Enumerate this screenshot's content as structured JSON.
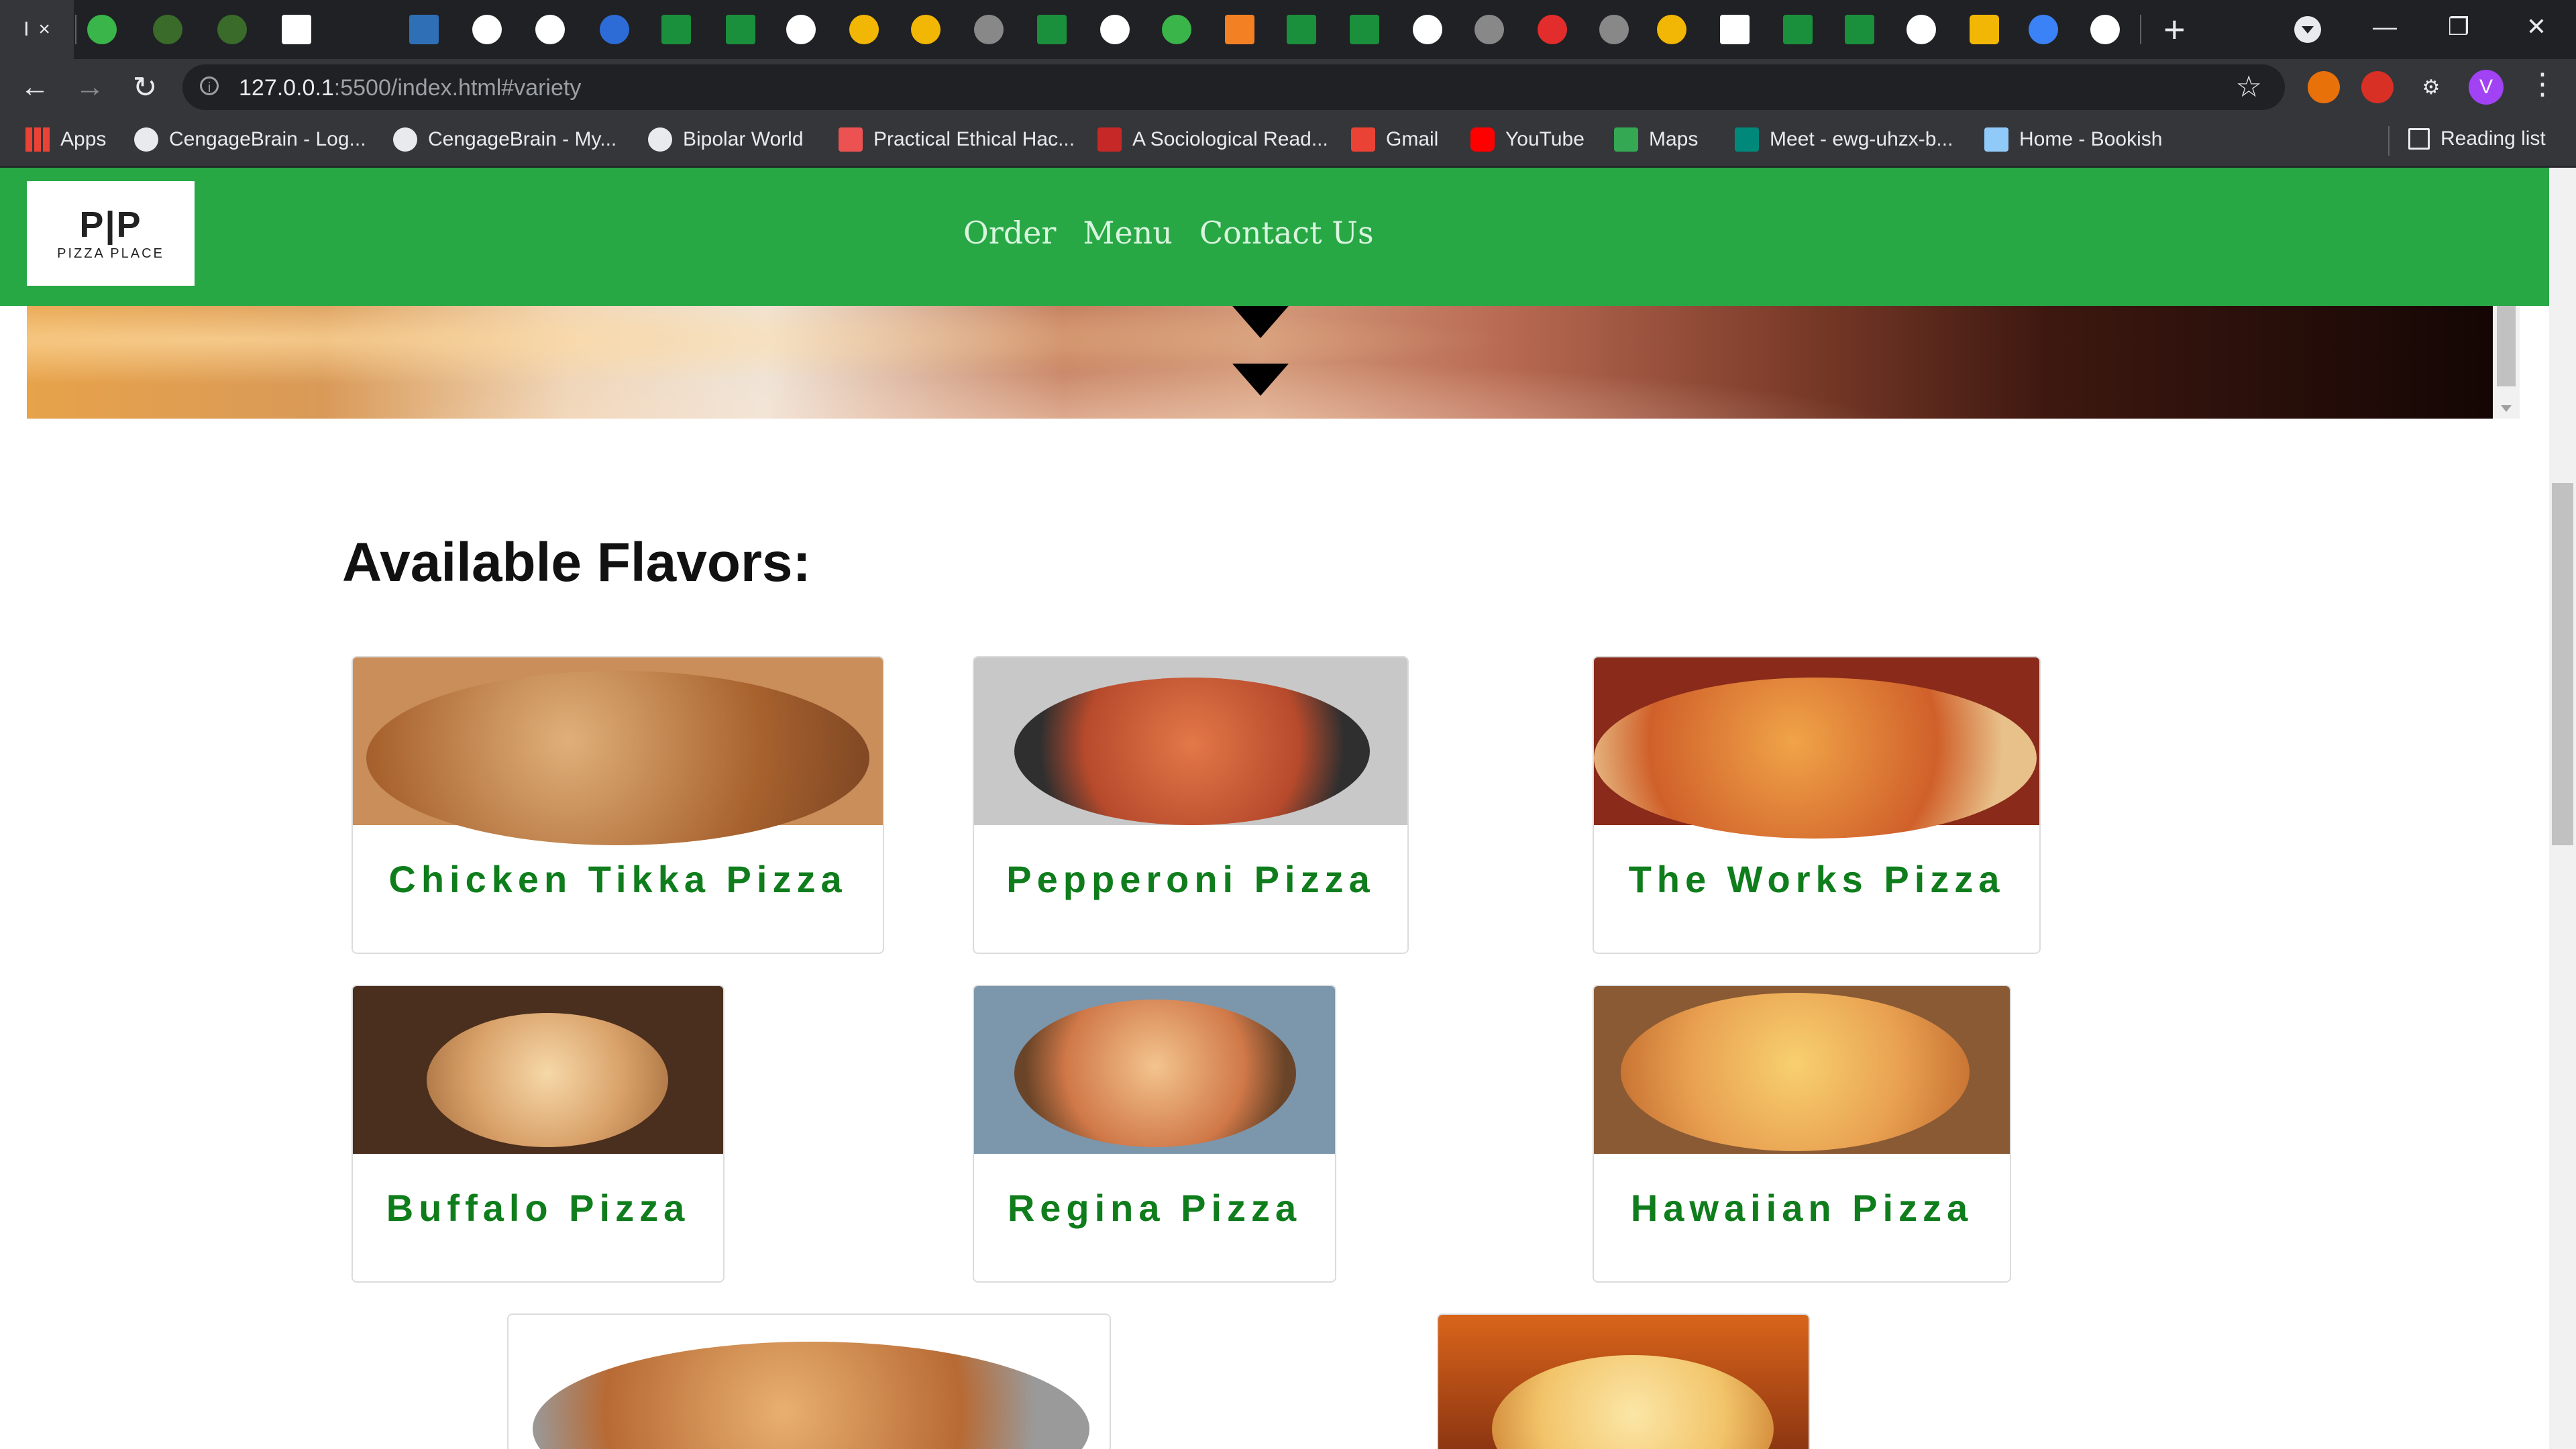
{
  "browser": {
    "tab_close": "×",
    "url_host": "127.0.0.1",
    "url_path": ":5500/index.html#variety",
    "avatar_letter": "V",
    "reading_list": "Reading list",
    "new_tab": "+",
    "colors": {
      "tabstrip": "#202124",
      "toolbar": "#35363a",
      "text": "#e8eaed"
    }
  },
  "bookmarks": [
    {
      "label": "Apps",
      "icon": "apps-grid-icon"
    },
    {
      "label": "CengageBrain - Log...",
      "icon": "globe-icon"
    },
    {
      "label": "CengageBrain - My...",
      "icon": "globe-icon"
    },
    {
      "label": "Bipolar World",
      "icon": "globe-icon"
    },
    {
      "label": "Practical Ethical Hac...",
      "icon": "udemy-icon"
    },
    {
      "label": "A Sociological Read...",
      "icon": "book-icon"
    },
    {
      "label": "Gmail",
      "icon": "gmail-icon"
    },
    {
      "label": "YouTube",
      "icon": "youtube-icon"
    },
    {
      "label": "Maps",
      "icon": "maps-icon"
    },
    {
      "label": "Meet - ewg-uhzx-b...",
      "icon": "meet-icon"
    },
    {
      "label": "Home - Bookish",
      "icon": "bookish-icon"
    }
  ],
  "site": {
    "logo_mark": "P|P",
    "logo_text": "PIZZA PLACE",
    "nav": [
      "Order",
      "Menu",
      "Contact Us"
    ],
    "header_color": "#28a745",
    "section_title": "Available Flavors:",
    "label_color": "#0f7d1c"
  },
  "flavors": [
    {
      "name": "Chicken Tikka Pizza"
    },
    {
      "name": "Pepperoni Pizza"
    },
    {
      "name": "The Works Pizza"
    },
    {
      "name": "Buffalo Pizza"
    },
    {
      "name": "Regina Pizza"
    },
    {
      "name": "Hawaiian Pizza"
    }
  ]
}
